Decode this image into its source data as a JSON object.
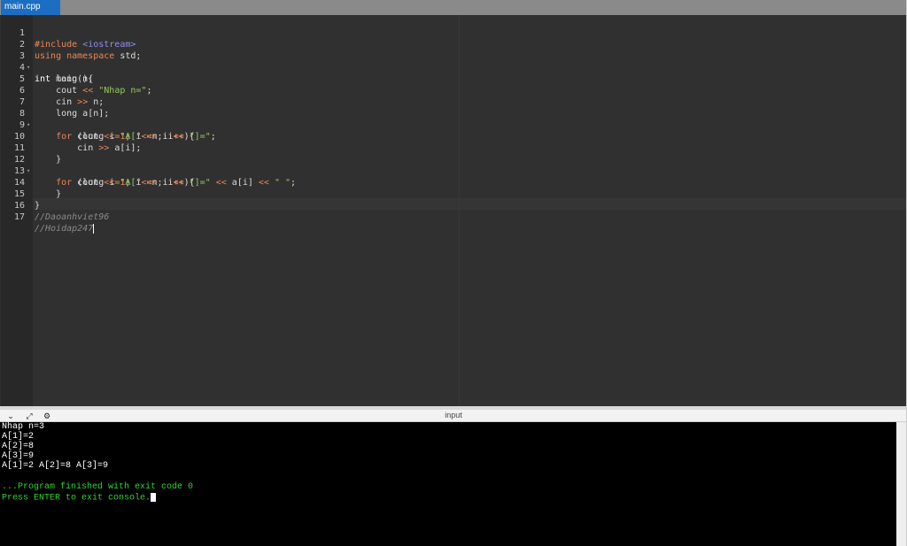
{
  "tab": {
    "label": "main.cpp"
  },
  "console": {
    "title": "input",
    "lines": [
      "Nhap n=3",
      "A[1]=2",
      "A[2]=8",
      "A[3]=9",
      "A[1]=2 A[2]=8 A[3]=9",
      ""
    ],
    "finished": "...Program finished with exit code 0",
    "press_enter": "Press ENTER to exit console."
  },
  "editor": {
    "line_numbers": [
      "1",
      "2",
      "3",
      "4",
      "5",
      "6",
      "7",
      "8",
      "9",
      "10",
      "11",
      "12",
      "13",
      "14",
      "15",
      "16",
      "17"
    ]
  },
  "code": {
    "l1_pp": "#include ",
    "l1_inc": "<iostream>",
    "l2_kw": "using namespace ",
    "l2_rest": "std;",
    "l3_ty": "int ",
    "l3_rest": "main(){",
    "l4": "    long n;",
    "l5_a": "    cout ",
    "l5_op": "<<",
    "l5_sp": " ",
    "l5_str": "\"Nhap n=\"",
    "l5_end": ";",
    "l6_a": "    cin ",
    "l6_op": ">>",
    "l6_b": " n;",
    "l7": "    long a[n];",
    "l8_ind": "    ",
    "l8_kw": "for",
    "l8_a": " (long i",
    "l8_op1": "=",
    "l8_n1": "1",
    "l8_b": "; i",
    "l8_op2": "<=",
    "l8_c": "n; i",
    "l8_op3": "++",
    "l8_d": "){",
    "l9_a": "        cout ",
    "l9_op1": "<<",
    "l9_s1": " \"A[\" ",
    "l9_op2": "<<",
    "l9_b": " i ",
    "l9_op3": "<<",
    "l9_s2": " \"]=\"",
    "l9_end": ";",
    "l10_a": "        cin ",
    "l10_op": ">>",
    "l10_b": " a[i];",
    "l11": "    }",
    "l12_ind": "    ",
    "l12_kw": "for",
    "l12_a": " (long i",
    "l12_op1": "=",
    "l12_n1": "1",
    "l12_b": "; i",
    "l12_op2": "<=",
    "l12_c": "n; i",
    "l12_op3": "++",
    "l12_d": "){",
    "l13_a": "        cout ",
    "l13_op1": "<<",
    "l13_s1": " \"A[\" ",
    "l13_op2": "<<",
    "l13_b": " i ",
    "l13_op3": "<<",
    "l13_s2": " \"]=\" ",
    "l13_op4": "<<",
    "l13_c": " a[i] ",
    "l13_op5": "<<",
    "l13_s3": " \" \"",
    "l13_end": ";",
    "l14": "    }",
    "l15": "}",
    "l16": "//Daoanhviet96",
    "l17": "//Hoidap247"
  },
  "icons": [
    "chevron-down-icon",
    "expand-icon",
    "settings-icon",
    "fold-arrow-icon"
  ]
}
